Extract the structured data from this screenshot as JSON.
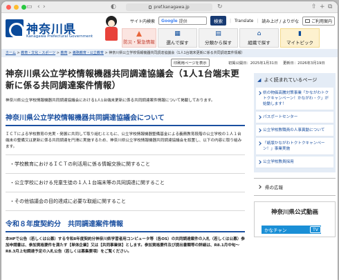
{
  "browser": {
    "url": "pref.kanagawa.jp"
  },
  "header": {
    "logo_name": "神奈川県",
    "logo_sub": "Kanagawa Prefectural Government",
    "site_tools_label": "サイト内検索",
    "search_brand": "Google",
    "search_suffix": "提供",
    "search_button": "検索",
    "translate": "Translate",
    "furigana": "読み上げ / よりがな",
    "contact": "ご利用案内"
  },
  "nav": {
    "emergency": "防災・緊急情報",
    "items": [
      {
        "label": "選んで探す",
        "icon": "grid-icon"
      },
      {
        "label": "分類から探す",
        "icon": "category-icon"
      },
      {
        "label": "組織で探す",
        "icon": "organization-icon"
      },
      {
        "label": "マイトピック",
        "icon": "bookmark-icon"
      }
    ]
  },
  "breadcrumb": {
    "items": [
      "ホーム",
      "教育・文化・スポーツ",
      "教育",
      "義務教育・公立教育"
    ],
    "current": "神奈川県公立学校情報機器共同調達協議会（1人1台端末更新に係る共同調達案件情報）"
  },
  "meta": {
    "print": "印刷用ページを表示",
    "published": "初掲公開日：2025年1月31日",
    "updated": "更新日：2026年3月19日"
  },
  "main": {
    "title": "神奈川県公立学校情報機器共同調達協議会（1人1台端末更新に係る共同調達案件情報）",
    "lead": "神奈川県公立学校情報機器共同調達協議会における1人1台端末更新に係る共同調達案件情報について掲載しております。",
    "section1_title": "神奈川県公立学校情報機器共同調達協議会について",
    "section1_text": "ＩＣＴによる学校教育の充実・発展に共同して取り組むとともに、公立学校情報機器整備基金による義務教育段階の公立学校の１人１台端末の整備又は更新に係る共同調達を円滑に実施するため、神奈川県公立学校情報機器共同調達協議会を設置し、以下の内容に取り組みます。",
    "bullets": [
      "・学校教育におけるＩＣＴの利活用に係る情報交換に関すること",
      "・公立学校における児童生徒の１人１台端末等の共同調達に関すること",
      "・その他協議会の目的達成に必要な取組に関すること"
    ],
    "section2_title": "令和８年度契約分　共同調達案件情報",
    "section2_text": "本HPで公告（若しくは公募）する令和8年度契約分神奈川県学習者用コンピュータ等（各OS）の共同調達案件の入札（若しくは公募）参加申請書は、参加資格要件を満たす【単体企業】又は【共同事業体】とします。参加資格要件及び提出書類等の詳細は、R8.1月中旬〜R8.3月上旬調達予定の入札公告（若しくは募集要項）をご覧ください。"
  },
  "sidebar": {
    "popular_title": "よく読まれているページ",
    "popular": [
      "県の物価高騰対策事業「かながわトクトクキャンペーン！かながわ・ク」が始動します！",
      "パスポートセンター",
      "公立学校教職員の人事異動について",
      "「紙版かながわトクトクキャンペーン！」事業実施",
      "公立学校教員採用"
    ],
    "pr_link": "県の広報",
    "video_title": "神奈川県公式動画",
    "video_banner": "かなチャン",
    "video_tv": "TV"
  },
  "colors": {
    "brand": "#0a4a9a",
    "link": "#1a4fa0",
    "emergency": "#c0392b"
  }
}
